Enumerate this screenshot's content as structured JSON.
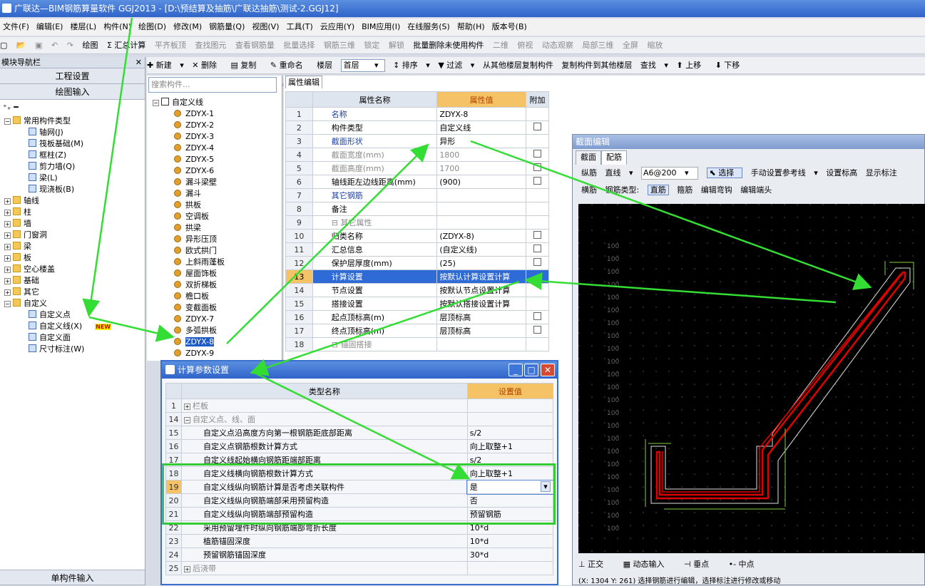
{
  "window": {
    "title": "广联达—BIM钢筋算量软件 GGJ2013 - [D:\\预结算及抽筋\\广联达抽筋\\测试-2.GGJ12]"
  },
  "menu": [
    "文件(F)",
    "编辑(E)",
    "楼层(L)",
    "构件(N)",
    "绘图(D)",
    "修改(M)",
    "钢筋量(Q)",
    "视图(V)",
    "工具(T)",
    "云应用(Y)",
    "BIM应用(I)",
    "在线服务(S)",
    "帮助(H)",
    "版本号(B)"
  ],
  "toolbar1": {
    "draw": "绘图",
    "sum": "Σ 汇总计算",
    "flat_roof": "平齐板顶",
    "find_elem": "查找图元",
    "view_rebar": "查看钢筋量",
    "batch_select": "批量选择",
    "rebar_3d": "钢筋三维",
    "lock": "锁定",
    "unlock": "解锁",
    "batch_delete": "批量删除未使用构件",
    "view_2d": "二维",
    "top_view": "俯视",
    "dynamic": "动态观察",
    "local_3d": "局部三维",
    "fullscreen": "全屏",
    "zoom": "缩放"
  },
  "nav": {
    "header": "模块导航栏",
    "btn_project": "工程设置",
    "btn_draw": "绘图输入",
    "btn_single": "单构件输入",
    "items": [
      {
        "label": "常用构件类型",
        "level": 0,
        "kind": "folder",
        "exp": "−"
      },
      {
        "label": "轴网(J)",
        "level": 1,
        "kind": "item"
      },
      {
        "label": "筏板基础(M)",
        "level": 1,
        "kind": "item"
      },
      {
        "label": "框柱(Z)",
        "level": 1,
        "kind": "item"
      },
      {
        "label": "剪力墙(Q)",
        "level": 1,
        "kind": "item"
      },
      {
        "label": "梁(L)",
        "level": 1,
        "kind": "item"
      },
      {
        "label": "现浇板(B)",
        "level": 1,
        "kind": "item"
      },
      {
        "label": "轴线",
        "level": 0,
        "kind": "folder",
        "exp": "+"
      },
      {
        "label": "柱",
        "level": 0,
        "kind": "folder",
        "exp": "+"
      },
      {
        "label": "墙",
        "level": 0,
        "kind": "folder",
        "exp": "+"
      },
      {
        "label": "门窗洞",
        "level": 0,
        "kind": "folder",
        "exp": "+"
      },
      {
        "label": "梁",
        "level": 0,
        "kind": "folder",
        "exp": "+"
      },
      {
        "label": "板",
        "level": 0,
        "kind": "folder",
        "exp": "+"
      },
      {
        "label": "空心楼盖",
        "level": 0,
        "kind": "folder",
        "exp": "+"
      },
      {
        "label": "基础",
        "level": 0,
        "kind": "folder",
        "exp": "+"
      },
      {
        "label": "其它",
        "level": 0,
        "kind": "folder",
        "exp": "+"
      },
      {
        "label": "自定义",
        "level": 0,
        "kind": "folder",
        "exp": "−"
      },
      {
        "label": "自定义点",
        "level": 1,
        "kind": "item"
      },
      {
        "label": "自定义线(X)",
        "level": 1,
        "kind": "item"
      },
      {
        "label": "自定义面",
        "level": 1,
        "kind": "item"
      },
      {
        "label": "尺寸标注(W)",
        "level": 1,
        "kind": "item"
      }
    ],
    "new_badge": "NEW"
  },
  "toolbar2": {
    "new": "新建",
    "delete": "删除",
    "copy": "复制",
    "rename": "重命名",
    "floor_label": "楼层",
    "floor_value": "首层",
    "sort": "排序",
    "filter": "过滤",
    "copy_from": "从其他楼层复制构件",
    "copy_to": "复制构件到其他楼层",
    "find": "查找",
    "up": "上移",
    "down": "下移"
  },
  "complist": {
    "search_placeholder": "搜索构件...",
    "root": "自定义线",
    "items": [
      "ZDYX-1",
      "ZDYX-2",
      "ZDYX-3",
      "ZDYX-4",
      "ZDYX-5",
      "ZDYX-6",
      "漏斗梁壁",
      "漏斗",
      "拱板",
      "空调板",
      "拱梁",
      "异形压顶",
      "欧式拱门",
      "上斜雨蓬板",
      "屋面饰板",
      "双折梯板",
      "檐口板",
      "变截面板",
      "ZDYX-7",
      "多弧拱板",
      "ZDYX-8",
      "ZDYX-9"
    ],
    "selected": "ZDYX-8"
  },
  "props": {
    "tab": "属性编辑",
    "headers": [
      "属性名称",
      "属性值",
      "附加"
    ],
    "rows": [
      {
        "n": "1",
        "name": "名称",
        "value": "ZDYX-8",
        "blue": true,
        "chk": false
      },
      {
        "n": "2",
        "name": "构件类型",
        "value": "自定义线",
        "chk": true
      },
      {
        "n": "3",
        "name": "截面形状",
        "value": "异形",
        "blue": true,
        "chk": false
      },
      {
        "n": "4",
        "name": "截面宽度(mm)",
        "value": "1800",
        "grey": true,
        "chk": true
      },
      {
        "n": "5",
        "name": "截面高度(mm)",
        "value": "1700",
        "grey": true,
        "chk": true
      },
      {
        "n": "6",
        "name": "轴线距左边线距离(mm)",
        "value": "(900)",
        "chk": true
      },
      {
        "n": "7",
        "name": "其它钢筋",
        "value": "",
        "blue": true,
        "chk": false
      },
      {
        "n": "8",
        "name": "备注",
        "value": "",
        "chk": false
      },
      {
        "n": "9",
        "name": "⊟ 其它属性",
        "value": "",
        "grey": true,
        "chk": false
      },
      {
        "n": "10",
        "name": "归类名称",
        "value": "(ZDYX-8)",
        "indent": true,
        "chk": true
      },
      {
        "n": "11",
        "name": "汇总信息",
        "value": "(自定义线)",
        "indent": true,
        "chk": true
      },
      {
        "n": "12",
        "name": "保护层厚度(mm)",
        "value": "(25)",
        "indent": true,
        "chk": true
      },
      {
        "n": "13",
        "name": "计算设置",
        "value": "按默认计算设置计算",
        "indent": true,
        "chk": false,
        "hl": true
      },
      {
        "n": "14",
        "name": "节点设置",
        "value": "按默认节点设置计算",
        "indent": true,
        "chk": false
      },
      {
        "n": "15",
        "name": "搭接设置",
        "value": "按默认搭接设置计算",
        "indent": true,
        "chk": false
      },
      {
        "n": "16",
        "name": "起点顶标高(m)",
        "value": "层顶标高",
        "indent": true,
        "chk": true
      },
      {
        "n": "17",
        "name": "终点顶标高(m)",
        "value": "层顶标高",
        "indent": true,
        "chk": true
      },
      {
        "n": "18",
        "name": "⊟ 锚固搭接",
        "value": "",
        "grey": true,
        "chk": false
      }
    ]
  },
  "section": {
    "title": "截面编辑",
    "tabs": [
      "截面",
      "配筋"
    ],
    "row1": {
      "dir": "纵筋",
      "line": "直线",
      "spec": "A6@200",
      "select": "选择",
      "ref": "手动设置参考线",
      "elev": "设置标高",
      "show": "显示标注"
    },
    "row2": {
      "horiz": "横筋",
      "type_label": "钢筋类型:",
      "straight": "直筋",
      "stirrup": "箍筋",
      "hook": "编辑弯钩",
      "end": "编辑端头"
    },
    "grid_labels": [
      "100",
      "100",
      "100",
      "100",
      "100",
      "100",
      "100",
      "100",
      "100",
      "100",
      "100",
      "100",
      "100",
      "100",
      "100",
      "100",
      "100",
      "100",
      "100",
      "100",
      "100",
      "100",
      "100"
    ],
    "footer": {
      "ortho": "正交",
      "dyn": "动态输入",
      "perp": "垂点",
      "mid": "中点"
    },
    "status": "(X: 1304 Y: 261)  选择钢筋进行编辑，选择标注进行修改或移动"
  },
  "calc": {
    "title": "计算参数设置",
    "headers": [
      "类型名称",
      "设置值"
    ],
    "rows": [
      {
        "n": "1",
        "name": "栏板",
        "value": "",
        "group": "+"
      },
      {
        "n": "14",
        "name": "自定义点、线、面",
        "value": "",
        "group": "−"
      },
      {
        "n": "15",
        "name": "自定义点沿高度方向第一根钢筋距底部距离",
        "value": "s/2"
      },
      {
        "n": "16",
        "name": "自定义点钢筋根数计算方式",
        "value": "向上取整+1"
      },
      {
        "n": "17",
        "name": "自定义线起始横向钢筋距端部距离",
        "value": "s/2"
      },
      {
        "n": "18",
        "name": "自定义线横向钢筋根数计算方式",
        "value": "向上取整+1"
      },
      {
        "n": "19",
        "name": "自定义线纵向钢筋计算是否考虑关联构件",
        "value": "是",
        "active": true
      },
      {
        "n": "20",
        "name": "自定义线纵向钢筋端部采用预留构造",
        "value": "否"
      },
      {
        "n": "21",
        "name": "自定义线纵向钢筋端部预留构造",
        "value": "预留钢筋"
      },
      {
        "n": "22",
        "name": "采用预留埋件时纵向钢筋端部弯折长度",
        "value": "10*d"
      },
      {
        "n": "23",
        "name": "植筋锚固深度",
        "value": "10*d"
      },
      {
        "n": "24",
        "name": "预留钢筋锚固深度",
        "value": "30*d"
      },
      {
        "n": "25",
        "name": "后浇带",
        "value": "",
        "group": "+"
      }
    ]
  },
  "colors": {
    "accent": "#2f63c9",
    "annotation": "#33cc33",
    "highlight": "#f6c266"
  }
}
